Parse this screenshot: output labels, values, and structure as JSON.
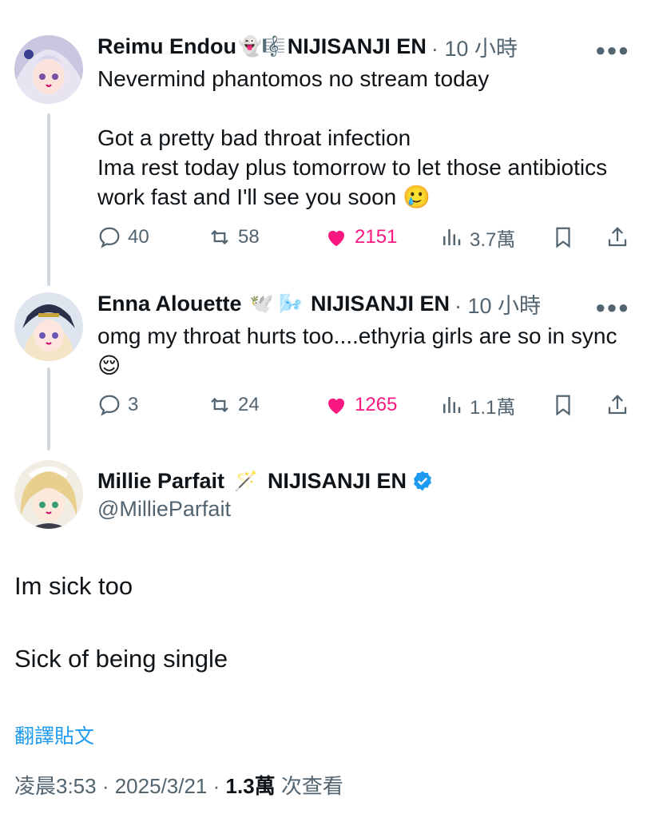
{
  "tweets": [
    {
      "name": "Reimu Endou",
      "emoji": "👻🎼",
      "org": "NIJISANJI EN",
      "time": "· 10 小時",
      "text": "Nevermind phantomos no stream today\n\nGot a pretty bad throat infection\nIma rest today plus tomorrow to let those antibiotics work fast and I'll see you soon 🥲",
      "replies": "40",
      "retweets": "58",
      "likes": "2151",
      "views": "3.7萬"
    },
    {
      "name": "Enna Alouette",
      "emoji": "🕊️ 🌬️",
      "org": "NIJISANJI EN",
      "time": "· 10 小時",
      "text": "omg my throat hurts too....ethyria girls are so in sync 😌",
      "replies": "3",
      "retweets": "24",
      "likes": "1265",
      "views": "1.1萬"
    }
  ],
  "main": {
    "name": "Millie Parfait",
    "emoji": "🪄",
    "org": "NIJISANJI EN",
    "handle": "@MillieParfait",
    "line1": "Im sick too",
    "line2": "Sick of being single",
    "translate": "翻譯貼文",
    "time": "凌晨3:53",
    "date": "· 2025/3/21 ·",
    "views_count": "1.3萬",
    "views_label": "次查看"
  },
  "colors": {
    "like": "#f91880",
    "muted": "#536471",
    "link": "#1d9bf0",
    "verified": "#1d9bf0"
  }
}
